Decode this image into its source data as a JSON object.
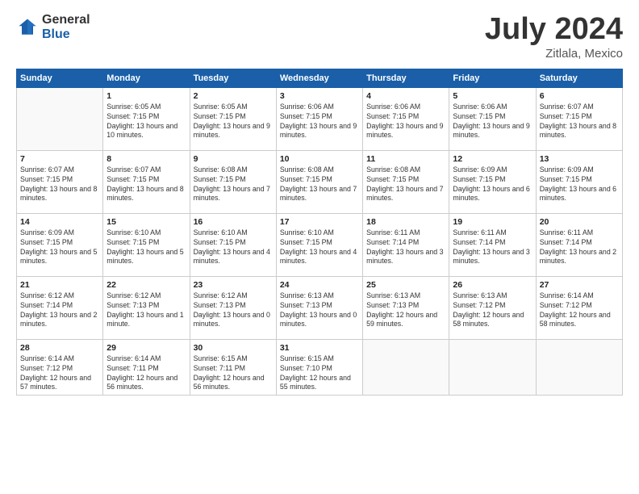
{
  "logo": {
    "general": "General",
    "blue": "Blue"
  },
  "title": {
    "month_year": "July 2024",
    "location": "Zitlala, Mexico"
  },
  "days_of_week": [
    "Sunday",
    "Monday",
    "Tuesday",
    "Wednesday",
    "Thursday",
    "Friday",
    "Saturday"
  ],
  "weeks": [
    [
      {
        "day": "",
        "sunrise": "",
        "sunset": "",
        "daylight": ""
      },
      {
        "day": "1",
        "sunrise": "Sunrise: 6:05 AM",
        "sunset": "Sunset: 7:15 PM",
        "daylight": "Daylight: 13 hours and 10 minutes."
      },
      {
        "day": "2",
        "sunrise": "Sunrise: 6:05 AM",
        "sunset": "Sunset: 7:15 PM",
        "daylight": "Daylight: 13 hours and 9 minutes."
      },
      {
        "day": "3",
        "sunrise": "Sunrise: 6:06 AM",
        "sunset": "Sunset: 7:15 PM",
        "daylight": "Daylight: 13 hours and 9 minutes."
      },
      {
        "day": "4",
        "sunrise": "Sunrise: 6:06 AM",
        "sunset": "Sunset: 7:15 PM",
        "daylight": "Daylight: 13 hours and 9 minutes."
      },
      {
        "day": "5",
        "sunrise": "Sunrise: 6:06 AM",
        "sunset": "Sunset: 7:15 PM",
        "daylight": "Daylight: 13 hours and 9 minutes."
      },
      {
        "day": "6",
        "sunrise": "Sunrise: 6:07 AM",
        "sunset": "Sunset: 7:15 PM",
        "daylight": "Daylight: 13 hours and 8 minutes."
      }
    ],
    [
      {
        "day": "7",
        "sunrise": "Sunrise: 6:07 AM",
        "sunset": "Sunset: 7:15 PM",
        "daylight": "Daylight: 13 hours and 8 minutes."
      },
      {
        "day": "8",
        "sunrise": "Sunrise: 6:07 AM",
        "sunset": "Sunset: 7:15 PM",
        "daylight": "Daylight: 13 hours and 8 minutes."
      },
      {
        "day": "9",
        "sunrise": "Sunrise: 6:08 AM",
        "sunset": "Sunset: 7:15 PM",
        "daylight": "Daylight: 13 hours and 7 minutes."
      },
      {
        "day": "10",
        "sunrise": "Sunrise: 6:08 AM",
        "sunset": "Sunset: 7:15 PM",
        "daylight": "Daylight: 13 hours and 7 minutes."
      },
      {
        "day": "11",
        "sunrise": "Sunrise: 6:08 AM",
        "sunset": "Sunset: 7:15 PM",
        "daylight": "Daylight: 13 hours and 7 minutes."
      },
      {
        "day": "12",
        "sunrise": "Sunrise: 6:09 AM",
        "sunset": "Sunset: 7:15 PM",
        "daylight": "Daylight: 13 hours and 6 minutes."
      },
      {
        "day": "13",
        "sunrise": "Sunrise: 6:09 AM",
        "sunset": "Sunset: 7:15 PM",
        "daylight": "Daylight: 13 hours and 6 minutes."
      }
    ],
    [
      {
        "day": "14",
        "sunrise": "Sunrise: 6:09 AM",
        "sunset": "Sunset: 7:15 PM",
        "daylight": "Daylight: 13 hours and 5 minutes."
      },
      {
        "day": "15",
        "sunrise": "Sunrise: 6:10 AM",
        "sunset": "Sunset: 7:15 PM",
        "daylight": "Daylight: 13 hours and 5 minutes."
      },
      {
        "day": "16",
        "sunrise": "Sunrise: 6:10 AM",
        "sunset": "Sunset: 7:15 PM",
        "daylight": "Daylight: 13 hours and 4 minutes."
      },
      {
        "day": "17",
        "sunrise": "Sunrise: 6:10 AM",
        "sunset": "Sunset: 7:15 PM",
        "daylight": "Daylight: 13 hours and 4 minutes."
      },
      {
        "day": "18",
        "sunrise": "Sunrise: 6:11 AM",
        "sunset": "Sunset: 7:14 PM",
        "daylight": "Daylight: 13 hours and 3 minutes."
      },
      {
        "day": "19",
        "sunrise": "Sunrise: 6:11 AM",
        "sunset": "Sunset: 7:14 PM",
        "daylight": "Daylight: 13 hours and 3 minutes."
      },
      {
        "day": "20",
        "sunrise": "Sunrise: 6:11 AM",
        "sunset": "Sunset: 7:14 PM",
        "daylight": "Daylight: 13 hours and 2 minutes."
      }
    ],
    [
      {
        "day": "21",
        "sunrise": "Sunrise: 6:12 AM",
        "sunset": "Sunset: 7:14 PM",
        "daylight": "Daylight: 13 hours and 2 minutes."
      },
      {
        "day": "22",
        "sunrise": "Sunrise: 6:12 AM",
        "sunset": "Sunset: 7:13 PM",
        "daylight": "Daylight: 13 hours and 1 minute."
      },
      {
        "day": "23",
        "sunrise": "Sunrise: 6:12 AM",
        "sunset": "Sunset: 7:13 PM",
        "daylight": "Daylight: 13 hours and 0 minutes."
      },
      {
        "day": "24",
        "sunrise": "Sunrise: 6:13 AM",
        "sunset": "Sunset: 7:13 PM",
        "daylight": "Daylight: 13 hours and 0 minutes."
      },
      {
        "day": "25",
        "sunrise": "Sunrise: 6:13 AM",
        "sunset": "Sunset: 7:13 PM",
        "daylight": "Daylight: 12 hours and 59 minutes."
      },
      {
        "day": "26",
        "sunrise": "Sunrise: 6:13 AM",
        "sunset": "Sunset: 7:12 PM",
        "daylight": "Daylight: 12 hours and 58 minutes."
      },
      {
        "day": "27",
        "sunrise": "Sunrise: 6:14 AM",
        "sunset": "Sunset: 7:12 PM",
        "daylight": "Daylight: 12 hours and 58 minutes."
      }
    ],
    [
      {
        "day": "28",
        "sunrise": "Sunrise: 6:14 AM",
        "sunset": "Sunset: 7:12 PM",
        "daylight": "Daylight: 12 hours and 57 minutes."
      },
      {
        "day": "29",
        "sunrise": "Sunrise: 6:14 AM",
        "sunset": "Sunset: 7:11 PM",
        "daylight": "Daylight: 12 hours and 56 minutes."
      },
      {
        "day": "30",
        "sunrise": "Sunrise: 6:15 AM",
        "sunset": "Sunset: 7:11 PM",
        "daylight": "Daylight: 12 hours and 56 minutes."
      },
      {
        "day": "31",
        "sunrise": "Sunrise: 6:15 AM",
        "sunset": "Sunset: 7:10 PM",
        "daylight": "Daylight: 12 hours and 55 minutes."
      },
      {
        "day": "",
        "sunrise": "",
        "sunset": "",
        "daylight": ""
      },
      {
        "day": "",
        "sunrise": "",
        "sunset": "",
        "daylight": ""
      },
      {
        "day": "",
        "sunrise": "",
        "sunset": "",
        "daylight": ""
      }
    ]
  ]
}
